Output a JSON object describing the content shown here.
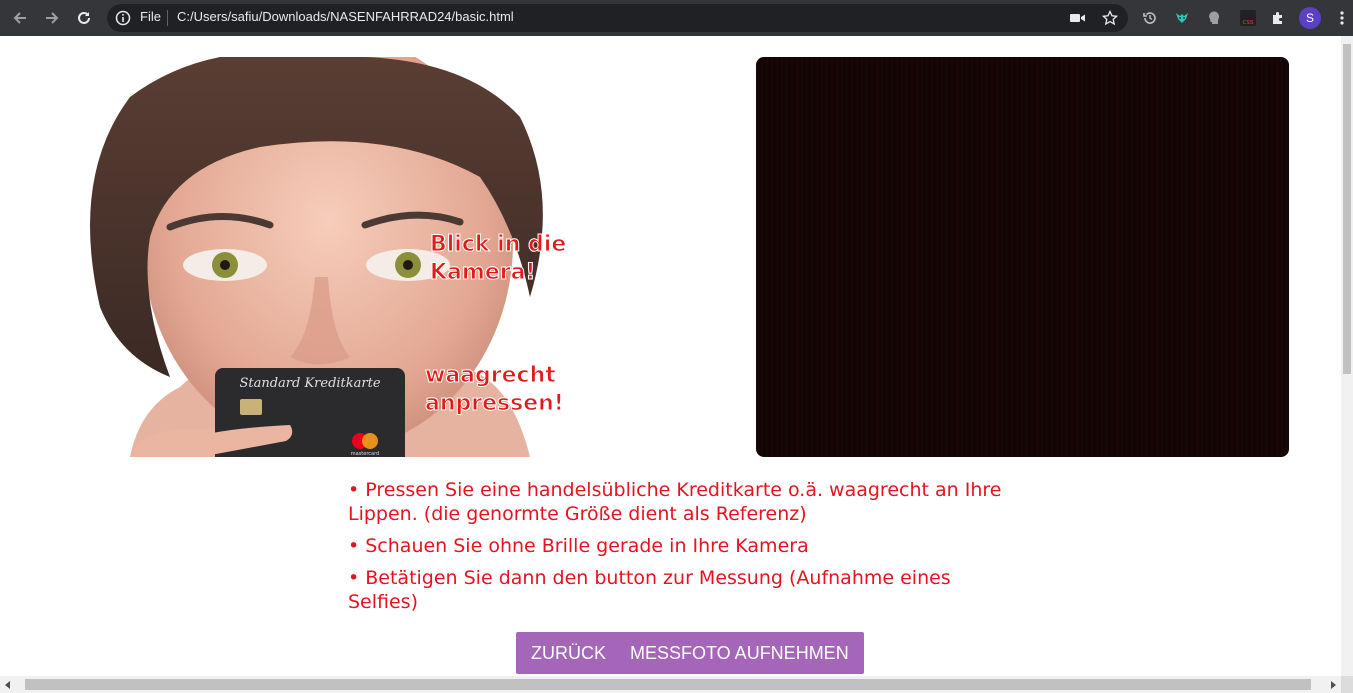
{
  "browser": {
    "scheme_label": "File",
    "url": "C:/Users/safiu/Downloads/NASENFAHRRAD24/basic.html",
    "profile_initial": "S",
    "ext_css_label": "css"
  },
  "portrait": {
    "card_title": "Standard Kreditkarte",
    "card_brand": "mastercard",
    "caption_look_line1": "Blick in die",
    "caption_look_line2": "Kamera!",
    "caption_press_line1": "waagrecht",
    "caption_press_line2": "anpressen!"
  },
  "instructions": [
    "• Pressen Sie eine handelsübliche Kreditkarte o.ä. waagrecht an Ihre Lippen. (die genormte Größe dient als Referenz)",
    "• Schauen Sie ohne Brille gerade in Ihre Kamera",
    "• Betätigen Sie dann den button zur Messung (Aufnahme eines Selfies)"
  ],
  "buttons": {
    "back": "ZURÜCK",
    "capture": "MESSFOTO AUFNEHMEN"
  },
  "colors": {
    "instruction_text": "#e8131f",
    "button_bg": "#a566ba",
    "camera_bg": "#120505",
    "chrome_bg": "#35363a"
  }
}
